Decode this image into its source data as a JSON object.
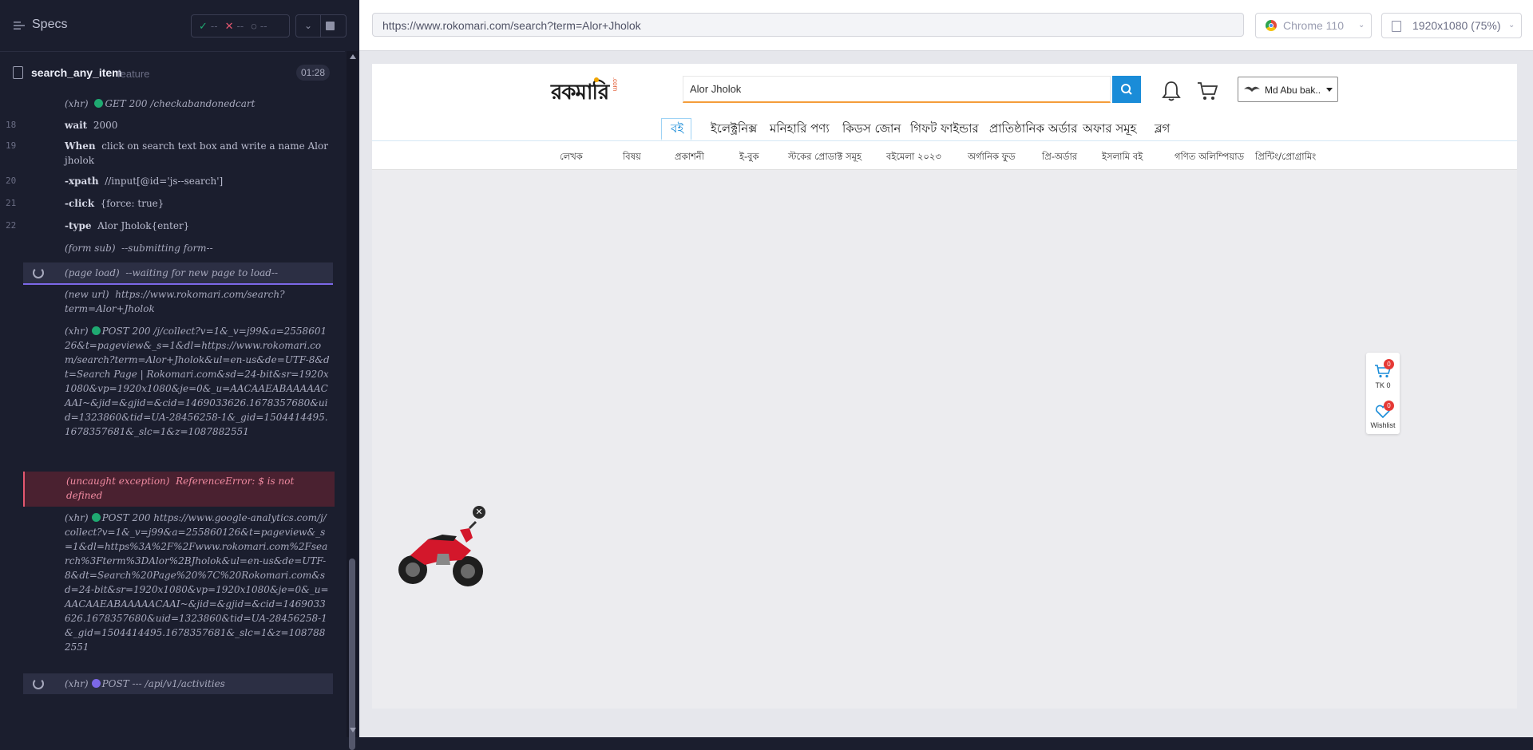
{
  "left_panel": {
    "title": "Specs",
    "stats": {
      "passed": "✓",
      "passed_count": "--",
      "failed": "✕",
      "failed_count": "--",
      "pending": "◌",
      "pending_count": "--"
    },
    "spec": {
      "name": "search_any_item",
      "ext": "feature",
      "time": "01:28"
    },
    "log": [
      {
        "num": "",
        "type": "xhr",
        "label": "(xhr)",
        "status_color": "#1fa971",
        "text": "GET 200 /checkabandonedcart"
      },
      {
        "num": "18",
        "cmd": "wait",
        "text": "2000"
      },
      {
        "num": "19",
        "cmd": "When",
        "text": "click on search text box and write a name Alor jholok"
      },
      {
        "num": "20",
        "cmd": "-xpath",
        "text": "//input[@id='js--search']"
      },
      {
        "num": "21",
        "cmd": "-click",
        "text": "{force: true}"
      },
      {
        "num": "22",
        "cmd": "-type",
        "text": "Alor Jholok{enter}"
      },
      {
        "num": "",
        "label": "(form sub)",
        "text": "--submitting form--"
      },
      {
        "num": "",
        "label": "(page load)",
        "text": "--waiting for new page to load--"
      },
      {
        "num": "",
        "label": "(new url)",
        "text": "https://www.rokomari.com/search?term=Alor+Jholok"
      },
      {
        "num": "",
        "label": "(xhr)",
        "status_color": "#1fa971",
        "text": "POST 200 /j/collect?v=1&_v=j99&a=255860126&t=pageview&_s=1&dl=https://www.rokomari.com/search?term=Alor+Jholok&ul=en-us&de=UTF-8&dt=Search Page | Rokomari.com&sd=24-bit&sr=1920x1080&vp=1920x1080&je=0&_u=AACAAEABAAAAACAAI~&jid=&gjid=&cid=1469033626.1678357680&uid=1323860&tid=UA-28456258-1&_gid=1504414495.1678357681&_slc=1&z=1087882551"
      },
      {
        "num": "",
        "label": "(uncaught exception)",
        "text": "ReferenceError: $ is not defined"
      },
      {
        "num": "",
        "label": "(xhr)",
        "status_color": "#1fa971",
        "text": "POST 200 https://www.google-analytics.com/j/collect?v=1&_v=j99&a=255860126&t=pageview&_s=1&dl=https%3A%2F%2Fwww.rokomari.com%2Fsearch%3Fterm%3DAlor%2BJholok&ul=en-us&de=UTF-8&dt=Search%20Page%20%7C%20Rokomari.com&sd=24-bit&sr=1920x1080&vp=1920x1080&je=0&_u=AACAAEABAAAAACAAI~&jid=&gjid=&cid=1469033626.1678357680&uid=1323860&tid=UA-28456258-1&_gid=1504414495.1678357681&_slc=1&z=1087882551"
      },
      {
        "num": "",
        "label": "(xhr)",
        "status_color": "#7c68e8",
        "text": "POST --- /api/v1/activities"
      }
    ]
  },
  "aut_header": {
    "url": "https://www.rokomari.com/search?term=Alor+Jholok",
    "browser": "Chrome 110",
    "viewport": "1920x1080 (75%)"
  },
  "site": {
    "logo": "রকমারি",
    "logo_sub": ".com",
    "search_value": "Alor Jholok",
    "user_name": "Md Abu bak...",
    "categories": [
      "বই",
      "ইলেক্ট্রনিক্স",
      "মনিহারি পণ্য",
      "কিডস জোন",
      "গিফট ফাইন্ডার",
      "প্রাতিষ্ঠানিক অর্ডার",
      "অফার সমূহ",
      "ব্লগ"
    ],
    "subnav": [
      "লেখক",
      "বিষয়",
      "প্রকাশনী",
      "ই-বুক",
      "স্টকের প্রোডাক্ট সমূহ",
      "বইমেলা ২০২৩",
      "অর্গানিক ফুড",
      "প্রি-অর্ডার",
      "ইসলামি বই",
      "গণিত অলিম্পিয়াড",
      "প্রিন্টিং/প্রোগ্রামিং"
    ],
    "cart_widget": {
      "count": "0",
      "label": "TK 0"
    },
    "wishlist_widget": {
      "count": "0",
      "label": "Wishlist"
    },
    "accent": "#1a8cd8"
  }
}
